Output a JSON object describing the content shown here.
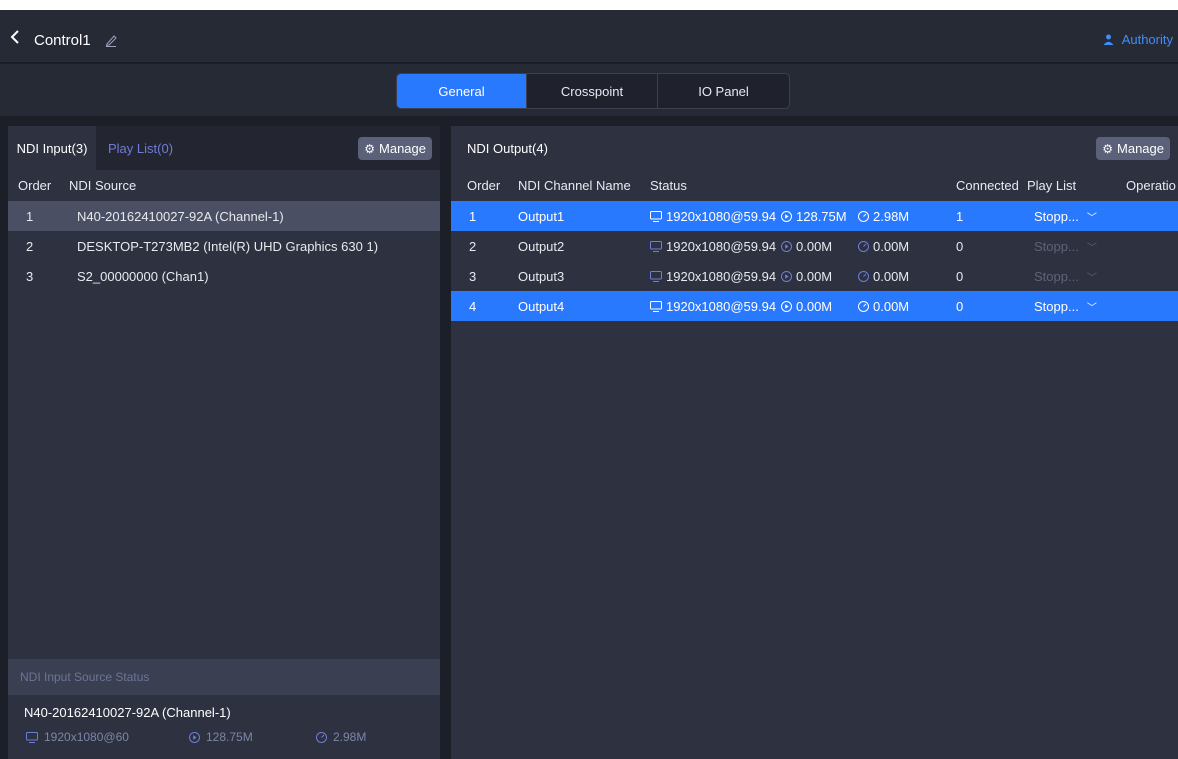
{
  "header": {
    "title": "Control1",
    "authority_label": "Authority"
  },
  "tabs": [
    {
      "label": "General",
      "active": true
    },
    {
      "label": "Crosspoint",
      "active": false
    },
    {
      "label": "IO Panel",
      "active": false
    }
  ],
  "left_panel": {
    "tab_active": "NDI Input(3)",
    "tab_other": "Play List(0)",
    "manage_label": "Manage",
    "columns": {
      "order": "Order",
      "source": "NDI Source"
    },
    "rows": [
      {
        "order": "1",
        "source": "N40-20162410027-92A (Channel-1)"
      },
      {
        "order": "2",
        "source": "DESKTOP-T273MB2 (Intel(R) UHD Graphics 630 1)"
      },
      {
        "order": "3",
        "source": "S2_00000000 (Chan1)"
      }
    ],
    "status": {
      "title": "NDI Input Source Status",
      "source": "N40-20162410027-92A (Channel-1)",
      "resolution": "1920x1080@60",
      "bitrate": "128.75M",
      "bandwidth": "2.98M"
    }
  },
  "right_panel": {
    "title": "NDI Output(4)",
    "manage_label": "Manage",
    "columns": {
      "order": "Order",
      "name": "NDI Channel Name",
      "status": "Status",
      "connected": "Connected",
      "playlist": "Play List",
      "operation": "Operatio"
    },
    "rows": [
      {
        "order": "1",
        "name": "Output1",
        "resolution": "1920x1080@59.94",
        "bitrate": "128.75M",
        "bandwidth": "2.98M",
        "connected": "1",
        "playlist": "Stopp..."
      },
      {
        "order": "2",
        "name": "Output2",
        "resolution": "1920x1080@59.94",
        "bitrate": "0.00M",
        "bandwidth": "0.00M",
        "connected": "0",
        "playlist": "Stopp..."
      },
      {
        "order": "3",
        "name": "Output3",
        "resolution": "1920x1080@59.94",
        "bitrate": "0.00M",
        "bandwidth": "0.00M",
        "connected": "0",
        "playlist": "Stopp..."
      },
      {
        "order": "4",
        "name": "Output4",
        "resolution": "1920x1080@59.94",
        "bitrate": "0.00M",
        "bandwidth": "0.00M",
        "connected": "0",
        "playlist": "Stopp..."
      }
    ]
  },
  "colors": {
    "accent": "#2979ff",
    "background": "#1c1f28",
    "panel": "#2d3140",
    "header": "#262a35",
    "authority": "#3f8cff"
  },
  "icons": {
    "back": "chevron-left-icon",
    "edit": "pencil-icon",
    "user": "user-icon",
    "manage": "gear-icon",
    "monitor": "monitor-icon",
    "play": "play-circle-icon",
    "gauge": "gauge-icon",
    "dropdown": "chevron-down-icon"
  }
}
